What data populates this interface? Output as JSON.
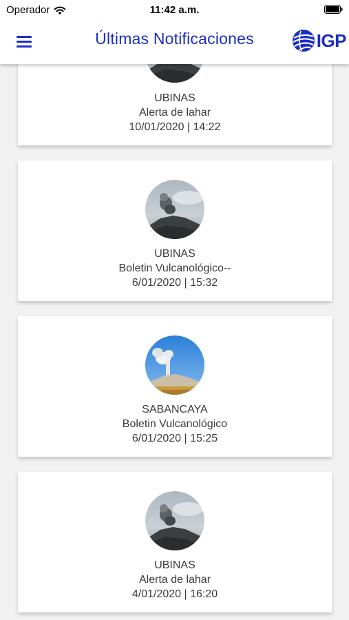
{
  "status_bar": {
    "carrier": "Operador",
    "time": "11:42 a.m."
  },
  "header": {
    "title": "Últimas Notificaciones",
    "logo_text": "IGP"
  },
  "colors": {
    "accent": "#1a2ec2",
    "card_bg": "#ffffff",
    "page_bg": "#f1f1f1"
  },
  "notifications": [
    {
      "volcano": "UBINAS",
      "type": "Alerta de lahar",
      "datetime": "10/01/2020 | 14:22",
      "image": "ubinas-cloudy-photo"
    },
    {
      "volcano": "UBINAS",
      "type": "Boletin Vulcanológico--",
      "datetime": "6/01/2020 | 15:32",
      "image": "ubinas-cloudy-photo"
    },
    {
      "volcano": "SABANCAYA",
      "type": "Boletin Vulcanológico",
      "datetime": "6/01/2020 | 15:25",
      "image": "sabancaya-blue-sky-photo"
    },
    {
      "volcano": "UBINAS",
      "type": "Alerta de lahar",
      "datetime": "4/01/2020 | 16:20",
      "image": "ubinas-cloudy-photo"
    }
  ]
}
